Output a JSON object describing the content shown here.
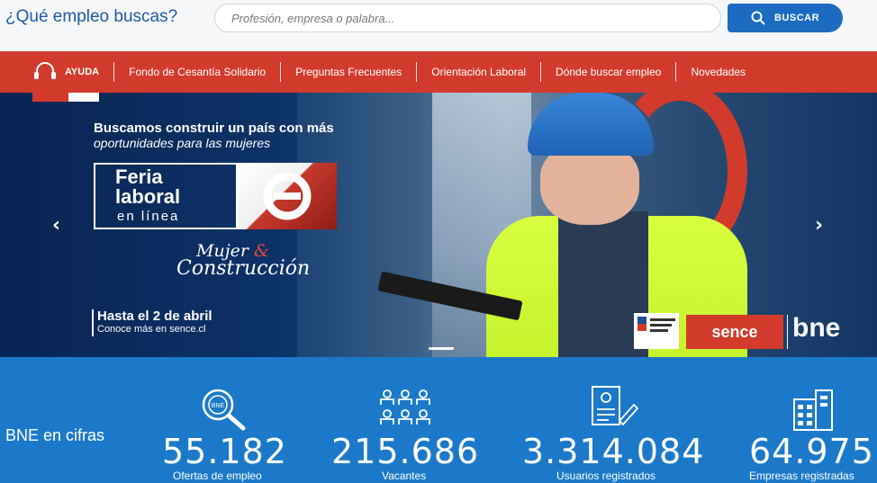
{
  "search": {
    "question": "¿Qué empleo buscas?",
    "placeholder": "Profesión, empresa o palabra...",
    "button_label": "BUSCAR"
  },
  "nav": {
    "help_label": "AYUDA",
    "items": [
      "Fondo de Cesantía Solidario",
      "Preguntas Frecuentes",
      "Orientación Laboral",
      "Dónde buscar empleo",
      "Novedades"
    ]
  },
  "hero": {
    "title": "Buscamos construir un país con más",
    "subtitle": "oportunidades para las mujeres",
    "feria_line1": "Feria",
    "feria_line2": "laboral",
    "feria_line3": "en línea",
    "script_line1_a": "Mujer ",
    "script_line1_amp": "&",
    "script_line2": "Construcción",
    "date": "Hasta el 2 de abril",
    "more_info": "Conoce más en sence.cl",
    "logo_sence": "sence",
    "logo_bne": "bne",
    "prev_label": "‹",
    "next_label": "›"
  },
  "stats": {
    "title": "BNE en cifras",
    "items": [
      {
        "value": "55.182",
        "label": "Ofertas de empleo",
        "icon": "search-bne-icon"
      },
      {
        "value": "215.686",
        "label": "Vacantes",
        "icon": "people-group-icon"
      },
      {
        "value": "3.314.084",
        "label": "Usuarios registrados",
        "icon": "user-document-icon"
      },
      {
        "value": "64.975",
        "label": "Empresas registradas",
        "icon": "building-icon"
      }
    ]
  },
  "colors": {
    "brand_blue": "#1c6bc0",
    "nav_red": "#d23b2c",
    "stats_blue": "#1c79c9"
  }
}
